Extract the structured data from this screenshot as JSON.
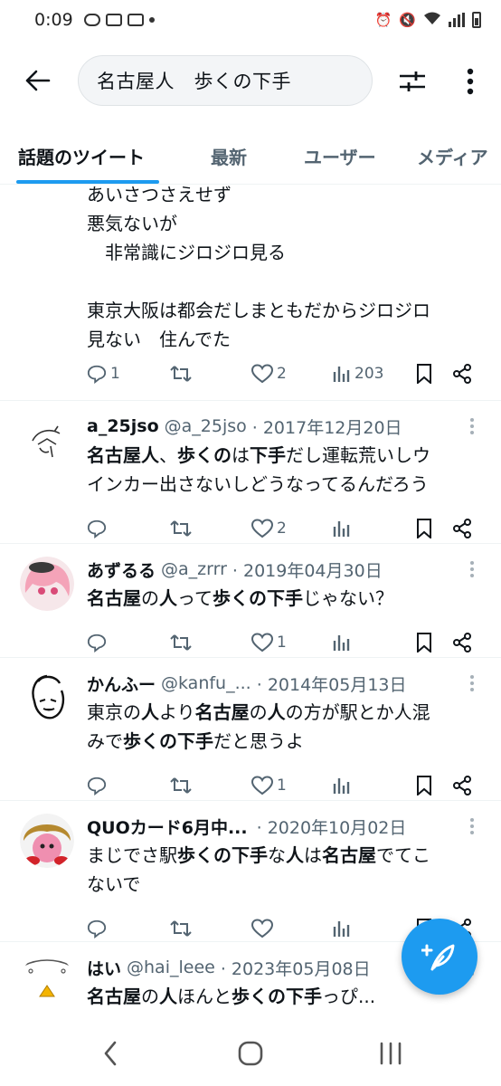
{
  "status_bar": {
    "time": "0:09"
  },
  "search": {
    "query": "名古屋人　歩くの下手"
  },
  "tabs": [
    "話題のツイート",
    "最新",
    "ユーザー",
    "メディア"
  ],
  "partial_tweet": {
    "lines": [
      "あいさつさえせず",
      "悪気ないが",
      "　非常識にジロジロ見る",
      "",
      "東京大阪は都会だしまともだからジロジロ",
      "見ない　住んでた"
    ],
    "replies": "1",
    "likes": "2",
    "views": "203"
  },
  "tweets": [
    {
      "name": "a_25jso",
      "handle": "@a_25jso",
      "date": "· 2017年12月20日",
      "body": [
        [
          {
            "t": "名古屋人",
            "b": true
          },
          {
            "t": "、"
          },
          {
            "t": "歩くの",
            "b": true
          },
          {
            "t": "は"
          },
          {
            "t": "下手",
            "b": true
          },
          {
            "t": "だし運転荒いしウ"
          }
        ],
        [
          {
            "t": "インカー出さないしどうなってるんだろう"
          }
        ]
      ],
      "replies": "",
      "likes": "2",
      "views": ""
    },
    {
      "name": "あずるる",
      "handle": "@a_zrrr",
      "date": "· 2019年04月30日",
      "body": [
        [
          {
            "t": "名古屋",
            "b": true
          },
          {
            "t": "の"
          },
          {
            "t": "人",
            "b": true
          },
          {
            "t": "って"
          },
          {
            "t": "歩くの下手",
            "b": true
          },
          {
            "t": "じゃない？"
          }
        ]
      ],
      "replies": "",
      "likes": "1",
      "views": ""
    },
    {
      "name": "かんふー",
      "handle": "@kanfu_...",
      "date": "· 2014年05月13日",
      "body": [
        [
          {
            "t": "東京の"
          },
          {
            "t": "人",
            "b": true
          },
          {
            "t": "より"
          },
          {
            "t": "名古屋",
            "b": true
          },
          {
            "t": "の"
          },
          {
            "t": "人",
            "b": true
          },
          {
            "t": "の方が駅とか人混"
          }
        ],
        [
          {
            "t": "みで"
          },
          {
            "t": "歩くの下手",
            "b": true
          },
          {
            "t": "だと思うよ"
          }
        ]
      ],
      "replies": "",
      "likes": "1",
      "views": ""
    },
    {
      "name": "QUOカード6月中...",
      "handle": "",
      "date": "· 2020年10月02日",
      "body": [
        [
          {
            "t": "まじでさ駅"
          },
          {
            "t": "歩くの下手",
            "b": true
          },
          {
            "t": "な"
          },
          {
            "t": "人",
            "b": true
          },
          {
            "t": "は"
          },
          {
            "t": "名古屋",
            "b": true
          },
          {
            "t": "でてこ"
          }
        ],
        [
          {
            "t": "ないで"
          }
        ]
      ],
      "replies": "",
      "likes": "",
      "views": ""
    },
    {
      "name": "はい",
      "handle": "@hai_leee",
      "date": "· 2023年05月08日",
      "body": [
        [
          {
            "t": "名古屋",
            "b": true
          },
          {
            "t": "の"
          },
          {
            "t": "人",
            "b": true
          },
          {
            "t": "ほんと"
          },
          {
            "t": "歩くの下手",
            "b": true
          },
          {
            "t": "っぴ..."
          }
        ]
      ],
      "replies": "",
      "likes": "",
      "views": ""
    }
  ],
  "colors": {
    "accent": "#1d9bf0",
    "text": "#0f1419",
    "muted": "#536471",
    "divider": "#eff3f4"
  },
  "icons": [
    "back-arrow-icon",
    "filter-sliders-icon",
    "more-vertical-icon",
    "reply-icon",
    "retweet-icon",
    "heart-icon",
    "views-icon",
    "bookmark-icon",
    "share-icon",
    "compose-feather-icon",
    "nav-back-icon",
    "nav-home-icon",
    "nav-recents-icon"
  ]
}
